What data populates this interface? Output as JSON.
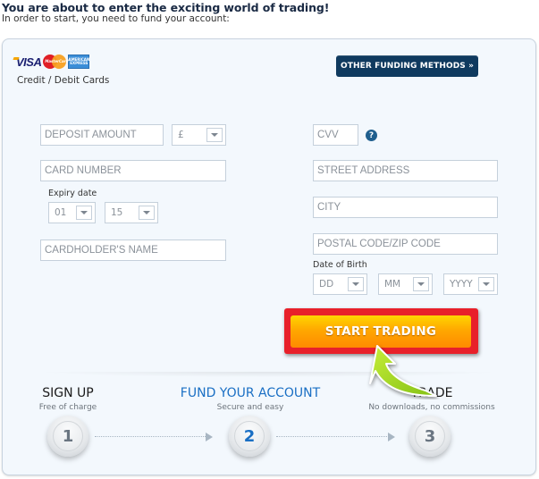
{
  "header": {
    "title": "You are about to enter the exciting world of trading!",
    "subtitle": "In order to start, you need to fund your account:"
  },
  "payment": {
    "logos": {
      "visa": "VISA",
      "mastercard": "MasterCard",
      "amex": "AMERICAN EXPRESS"
    },
    "method_label": "Credit / Debit Cards",
    "other_methods_button": "OTHER FUNDING METHODS »"
  },
  "form": {
    "deposit_amount": {
      "placeholder": "DEPOSIT AMOUNT",
      "value": ""
    },
    "currency": {
      "value": "£"
    },
    "card_number": {
      "placeholder": "CARD NUMBER",
      "value": ""
    },
    "expiry_label": "Expiry date",
    "expiry_month": {
      "value": "01"
    },
    "expiry_year": {
      "value": "15"
    },
    "cardholder_name": {
      "placeholder": "CARDHOLDER'S NAME",
      "value": ""
    },
    "cvv": {
      "placeholder": "CVV",
      "value": ""
    },
    "cvv_help": "?",
    "street_address": {
      "placeholder": "STREET ADDRESS",
      "value": ""
    },
    "city": {
      "placeholder": "CITY",
      "value": ""
    },
    "postal_code": {
      "placeholder": "POSTAL CODE/ZIP CODE",
      "value": ""
    },
    "dob_label": "Date of Birth",
    "dob_day": {
      "value": "DD"
    },
    "dob_month": {
      "value": "MM"
    },
    "dob_year": {
      "value": "YYYY"
    },
    "submit_button": "START TRADING"
  },
  "steps": [
    {
      "number": "1",
      "title": "SIGN UP",
      "subtitle": "Free of charge",
      "active": false
    },
    {
      "number": "2",
      "title": "FUND YOUR ACCOUNT",
      "subtitle": "Secure and easy",
      "active": true
    },
    {
      "number": "3",
      "title": "TRADE",
      "subtitle": "No downloads, no commissions",
      "active": false
    }
  ],
  "colors": {
    "active_step": "#1a6fc4",
    "highlight_border": "#e8202a",
    "primary_button": "#0f3a5f",
    "cta_orange": "#ffa800",
    "pointer_arrow": "#9ad31a"
  }
}
